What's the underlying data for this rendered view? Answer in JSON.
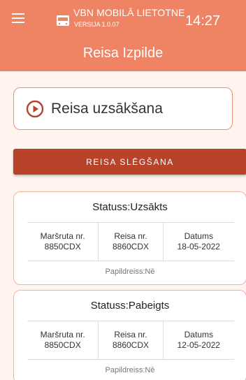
{
  "header": {
    "app_name": "VBN MOBILĀ LIETOTNE",
    "version": "VERSIJA 1.0.07",
    "time": "14:27",
    "title": "Reisa Izpilde",
    "accent": "#ef8464"
  },
  "start": {
    "label": "Reisa uzsākšana",
    "icon": "play-circle-icon"
  },
  "close_button": {
    "label": "REISA SLĒGŠANA",
    "color": "#b8432b"
  },
  "trips": [
    {
      "status": "Statuss:Uzsākts",
      "route_label": "Maršruta nr.",
      "route_value": "8850CDX",
      "trip_label": "Reisa nr.",
      "trip_value": "8860CDX",
      "date_label": "Datums",
      "date_value": "18-05-2022",
      "extra": "Papildreiss:Nē"
    },
    {
      "status": "Statuss:Pabeigts",
      "route_label": "Maršruta nr.",
      "route_value": "8850CDX",
      "trip_label": "Reisa nr.",
      "trip_value": "8860CDX",
      "date_label": "Datums",
      "date_value": "12-05-2022",
      "extra": "Papildreiss:Nē"
    }
  ]
}
